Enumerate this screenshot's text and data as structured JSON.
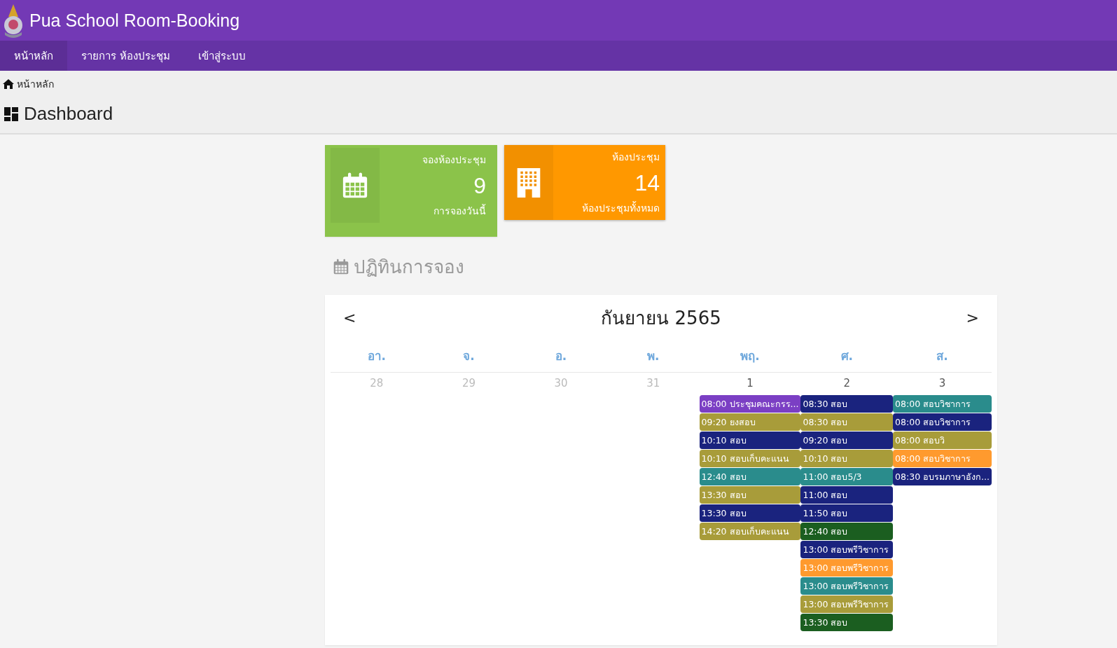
{
  "brand": {
    "title": "Pua School Room-Booking"
  },
  "nav": [
    {
      "label": "หน้าหลัก",
      "selected": true
    },
    {
      "label": "รายการ ห้องประชุม",
      "selected": false
    },
    {
      "label": "เข้าสู่ระบบ",
      "selected": false
    }
  ],
  "breadcrumb": "หน้าหลัก",
  "page_title": "Dashboard",
  "stats": [
    {
      "kind": "calendar",
      "color": "#8bc34a",
      "title": "จองห้องประชุม",
      "value": "9",
      "caption": "การจองวันนี้"
    },
    {
      "kind": "building",
      "color": "#ff9800",
      "title": "ห้องประชุม",
      "value": "14",
      "caption": "ห้องประชุมทั้งหมด"
    }
  ],
  "calendar_heading": "ปฏิทินการจอง",
  "calendar": {
    "prev": "<",
    "month": "กันยายน 2565",
    "next": ">",
    "weekdays": [
      "อา.",
      "จ.",
      "อ.",
      "พ.",
      "พฤ.",
      "ศ.",
      "ส."
    ],
    "days": [
      {
        "num": "28",
        "other_month": true
      },
      {
        "num": "29",
        "other_month": true
      },
      {
        "num": "30",
        "other_month": true
      },
      {
        "num": "31",
        "other_month": true
      },
      {
        "num": "1",
        "other_month": false,
        "events": [
          {
            "label": "08:00 ประชุมคณะกรร...",
            "color": "#7b3fc4"
          },
          {
            "label": "09:20 ยงสอบ",
            "color": "#a89c3a"
          },
          {
            "label": "10:10 สอบ",
            "color": "#1a237e"
          },
          {
            "label": "10:10 สอบเก็บคะแนน",
            "color": "#a89c3a"
          },
          {
            "label": "12:40 สอบ",
            "color": "#2a8c8c"
          },
          {
            "label": "13:30 สอบ",
            "color": "#a89c3a"
          },
          {
            "label": "13:30 สอบ",
            "color": "#1a237e"
          },
          {
            "label": "14:20 สอบเก็บคะแนน",
            "color": "#a89c3a"
          }
        ]
      },
      {
        "num": "2",
        "other_month": false,
        "events": [
          {
            "label": "08:30 สอบ",
            "color": "#1a237e"
          },
          {
            "label": "08:30 สอบ",
            "color": "#a89c3a"
          },
          {
            "label": "09:20 สอบ",
            "color": "#1a237e"
          },
          {
            "label": "10:10 สอบ",
            "color": "#a89c3a"
          },
          {
            "label": "11:00 สอบ5/3",
            "color": "#2a8c8c"
          },
          {
            "label": "11:00 สอบ",
            "color": "#1a237e"
          },
          {
            "label": "11:50 สอบ",
            "color": "#1a237e"
          },
          {
            "label": "12:40 สอบ",
            "color": "#1b5e20"
          },
          {
            "label": "13:00 สอบพรีวิชาการ",
            "color": "#1a237e"
          },
          {
            "label": "13:00 สอบพรีวิชาการ",
            "color": "#ff9a2e"
          },
          {
            "label": "13:00 สอบพรีวิชาการ",
            "color": "#2a8c8c"
          },
          {
            "label": "13:00 สอบพรีวิชาการ",
            "color": "#a89c3a"
          },
          {
            "label": "13:30 สอบ",
            "color": "#1b5e20"
          }
        ]
      },
      {
        "num": "3",
        "other_month": false,
        "events": [
          {
            "label": "08:00 สอบวิชาการ",
            "color": "#2a8c8c"
          },
          {
            "label": "08:00 สอบวิชาการ",
            "color": "#1a237e"
          },
          {
            "label": "08:00 สอบวิ",
            "color": "#a89c3a"
          },
          {
            "label": "08:00 สอบวิชาการ",
            "color": "#ff9a2e"
          },
          {
            "label": "08:30 อบรมภาษาอังก...",
            "color": "#1a237e"
          }
        ]
      }
    ]
  }
}
